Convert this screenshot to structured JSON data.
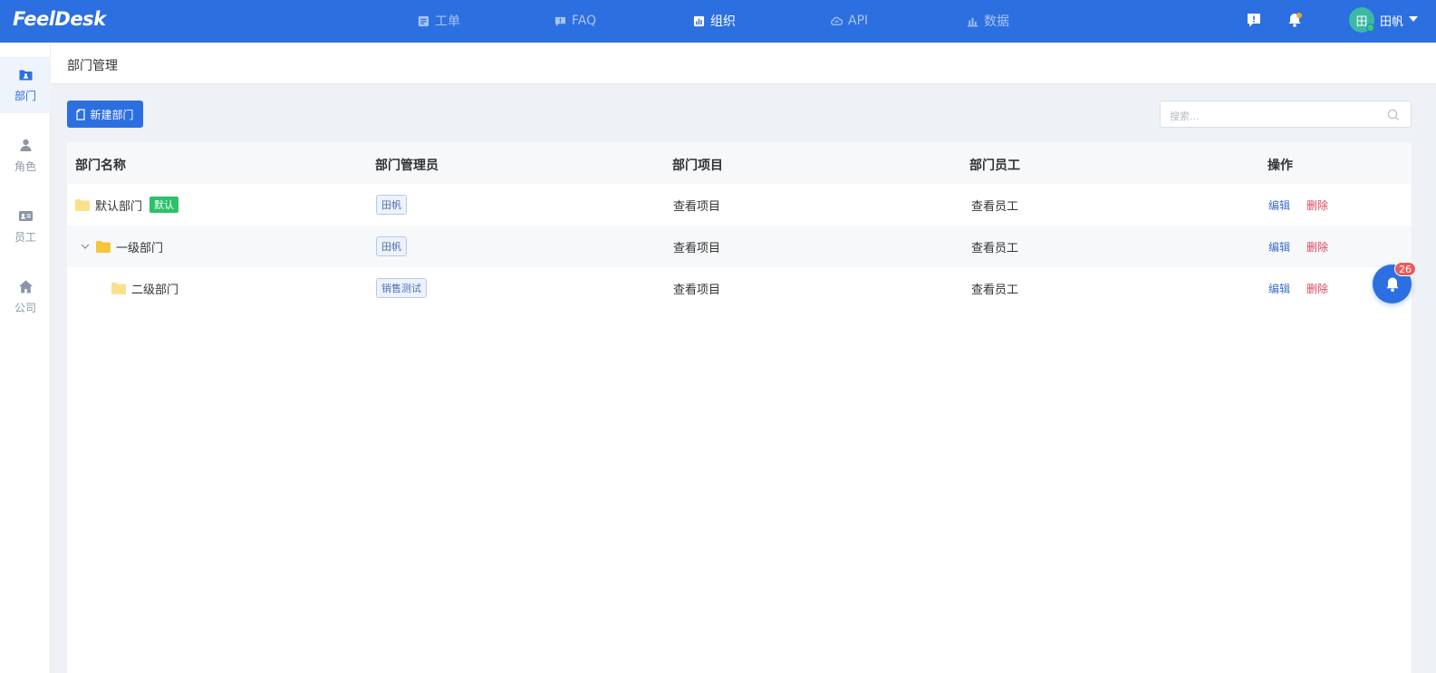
{
  "app": {
    "logo": "FeelDesk"
  },
  "nav": {
    "items": [
      {
        "label": "工单",
        "icon": "ticket-icon",
        "active": false
      },
      {
        "label": "FAQ",
        "icon": "faq-icon",
        "active": false
      },
      {
        "label": "组织",
        "icon": "org-chart-icon",
        "active": true
      },
      {
        "label": "API",
        "icon": "api-cloud-icon",
        "active": false
      },
      {
        "label": "数据",
        "icon": "data-bars-icon",
        "active": false
      }
    ]
  },
  "user": {
    "avatar_text": "田",
    "name": "田帆"
  },
  "sidebar": {
    "items": [
      {
        "label": "部门",
        "icon": "department-icon",
        "active": true
      },
      {
        "label": "角色",
        "icon": "role-icon",
        "active": false
      },
      {
        "label": "员工",
        "icon": "employee-card-icon",
        "active": false
      },
      {
        "label": "公司",
        "icon": "company-home-icon",
        "active": false
      }
    ]
  },
  "page": {
    "title": "部门管理"
  },
  "toolbar": {
    "new_label": "新建部门",
    "search_placeholder": "搜索..."
  },
  "table": {
    "columns": [
      "部门名称",
      "部门管理员",
      "部门项目",
      "部门员工",
      "操作"
    ],
    "rows": [
      {
        "name": "默认部门",
        "badge": "默认",
        "manager": "田帆",
        "project_link": "查看项目",
        "staff_link": "查看员工",
        "edit": "编辑",
        "delete": "删除"
      },
      {
        "name": "一级部门",
        "manager": "田帆",
        "project_link": "查看项目",
        "staff_link": "查看员工",
        "edit": "编辑",
        "delete": "删除"
      },
      {
        "name": "二级部门",
        "manager": "销售测试",
        "project_link": "查看项目",
        "staff_link": "查看员工",
        "edit": "编辑",
        "delete": "删除"
      }
    ]
  },
  "notifications": {
    "count": "26"
  },
  "colors": {
    "primary": "#2c6fe0",
    "success": "#2cc16a",
    "danger": "#e0455c",
    "folder": "#f7d46a"
  }
}
